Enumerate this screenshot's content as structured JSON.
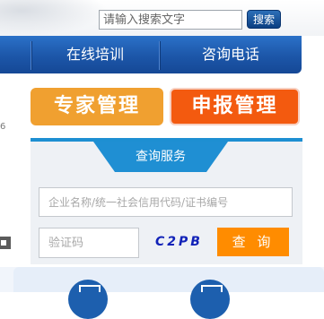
{
  "header": {
    "search_placeholder": "请输入搜索文字",
    "search_button": "搜索"
  },
  "nav": {
    "items": [
      {
        "label": "在线培训"
      },
      {
        "label": "咨询电话"
      }
    ]
  },
  "left_fragment": {
    "text": "6"
  },
  "cards": {
    "expert": "专家管理",
    "declare": "申报管理"
  },
  "query_panel": {
    "tab": "查询服务",
    "company_placeholder": "企业名称/统一社会信用代码/证书编号",
    "code_placeholder": "验证码",
    "captcha": "C2PB",
    "query_button": "查 询"
  },
  "colors": {
    "nav_blue": "#1c56a8",
    "tab_blue": "#1f8fd3",
    "expert_orange": "#f0a030",
    "declare_orange": "#f35a0f",
    "query_orange": "#ff8c00"
  }
}
